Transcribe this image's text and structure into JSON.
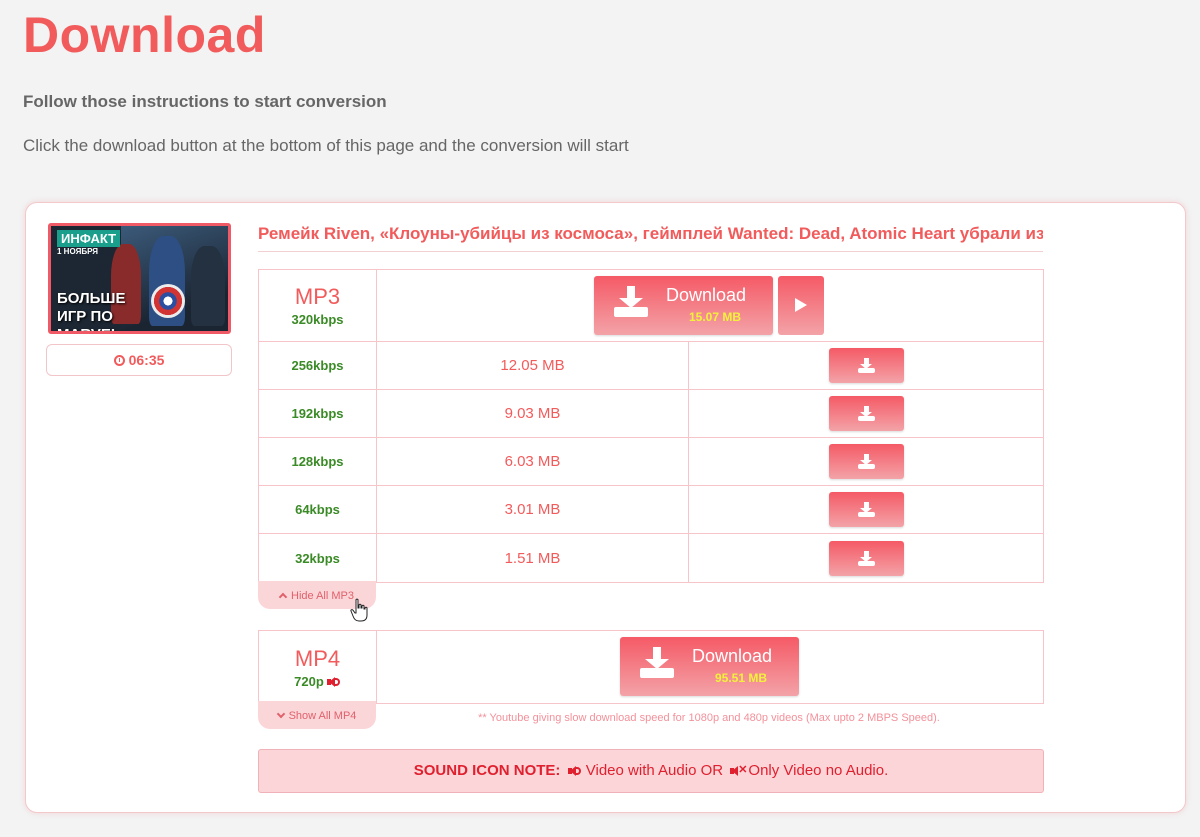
{
  "page": {
    "title": "Download",
    "instructions_heading": "Follow those instructions to start conversion",
    "instructions_text": "Click the download button at the bottom of this page and the conversion will start"
  },
  "video": {
    "title": "Ремейк Riven, «Клоуны-убийцы из космоса», геймплей Wanted: Dead, Atomic Heart убрали из ...",
    "duration": "06:35",
    "thumbnail": {
      "badge": "ИНФАКТ",
      "badge_sub": "1 НОЯБРЯ",
      "overlay_text": "БОЛЬШЕ ИГР ПО MARVEL"
    }
  },
  "mp3": {
    "format_label": "MP3",
    "main_quality": "320kbps",
    "main_button_label": "Download",
    "main_size": "15.07 MB",
    "rows": [
      {
        "quality": "256kbps",
        "size": "12.05 MB"
      },
      {
        "quality": "192kbps",
        "size": "9.03 MB"
      },
      {
        "quality": "128kbps",
        "size": "6.03 MB"
      },
      {
        "quality": "64kbps",
        "size": "3.01 MB"
      },
      {
        "quality": "32kbps",
        "size": "1.51 MB"
      }
    ],
    "toggle_label": "Hide All MP3"
  },
  "mp4": {
    "format_label": "MP4",
    "main_quality": "720p",
    "main_button_label": "Download",
    "main_size": "95.51 MB",
    "toggle_label": "Show All MP4"
  },
  "notes": {
    "youtube_speed": "** Youtube giving slow download speed for 1080p and 480p videos (Max upto 2 MBPS Speed).",
    "sound_note_label": "SOUND ICON NOTE:",
    "sound_with_audio": "Video with Audio OR",
    "sound_no_audio": "Only Video no Audio."
  },
  "colors": {
    "accent": "#f25b5b",
    "quality_green": "#3a8a26",
    "size_yellow": "#f2f23a",
    "panel_pink": "#fcd5d8"
  },
  "icons": {
    "download": "download-icon",
    "play": "play-icon",
    "clock": "clock-icon",
    "volume": "volume-icon",
    "mute": "mute-icon",
    "chevron_up": "chevron-up-icon",
    "chevron_down": "chevron-down-icon"
  }
}
